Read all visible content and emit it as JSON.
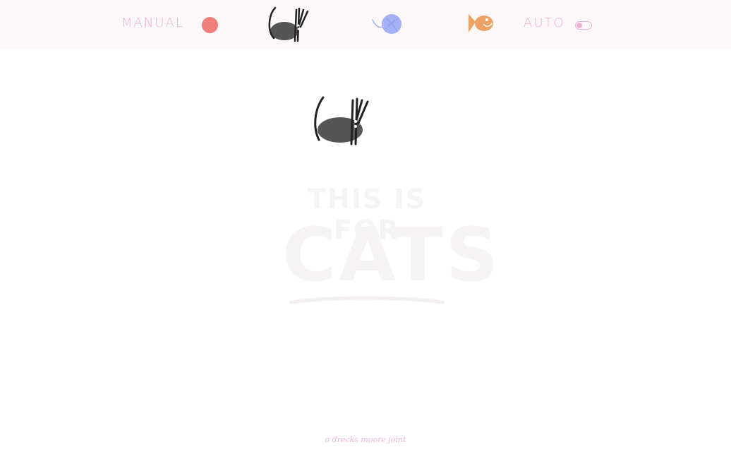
{
  "header": {
    "manual_label": "MANUAL",
    "auto_label": "AUTO",
    "icons": [
      "red-dot-icon",
      "cat-icon",
      "yarn-ball-icon",
      "fish-icon",
      "toggle-icon"
    ]
  },
  "main": {
    "mascot_icon": "cat-icon",
    "watermark_line1": "THIS IS FOR",
    "watermark_line2": "CATS"
  },
  "footer": {
    "credit": "a drecks moore joint"
  },
  "colors": {
    "pink": "#eab3d6",
    "red": "#ef7f7c",
    "blue": "#a5b0f5",
    "orange": "#eca267",
    "cat": "#555555"
  }
}
